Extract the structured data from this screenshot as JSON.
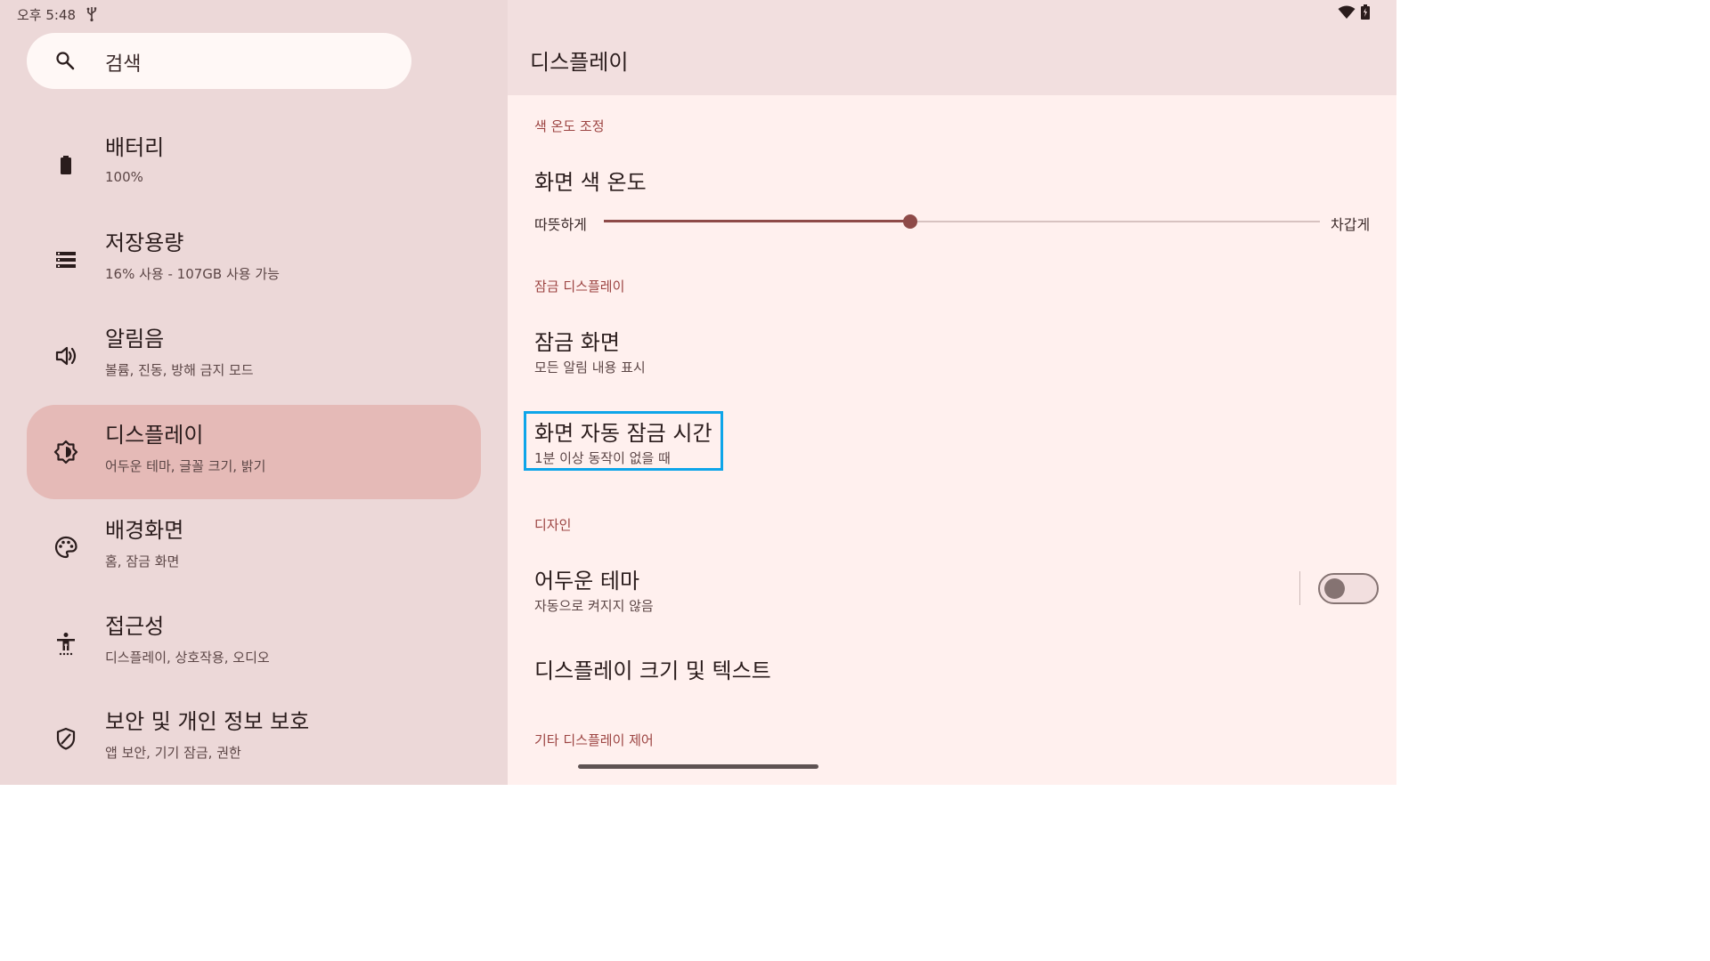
{
  "status_bar": {
    "time": "오후 5:48",
    "icons": [
      "usb-icon",
      "wifi-icon",
      "battery-icon"
    ]
  },
  "search": {
    "placeholder": "검색"
  },
  "sidebar": {
    "items": [
      {
        "icon": "battery-icon",
        "title": "배터리",
        "subtitle": "100%",
        "selected": false
      },
      {
        "icon": "storage-icon",
        "title": "저장용량",
        "subtitle": "16% 사용 - 107GB 사용 가능",
        "selected": false
      },
      {
        "icon": "volume-icon",
        "title": "알림음",
        "subtitle": "볼륨, 진동, 방해 금지 모드",
        "selected": false
      },
      {
        "icon": "brightness-icon",
        "title": "디스플레이",
        "subtitle": "어두운 테마, 글꼴 크기, 밝기",
        "selected": true
      },
      {
        "icon": "palette-icon",
        "title": "배경화면",
        "subtitle": "홈, 잠금 화면",
        "selected": false
      },
      {
        "icon": "accessibility-icon",
        "title": "접근성",
        "subtitle": "디스플레이, 상호작용, 오디오",
        "selected": false
      },
      {
        "icon": "shield-icon",
        "title": "보안 및 개인 정보 보호",
        "subtitle": "앱 보안, 기기 잠금, 권한",
        "selected": false
      }
    ]
  },
  "main": {
    "title": "디스플레이",
    "sections": {
      "color_temp_header": "색 온도 조정",
      "color_temp_title": "화면 색 온도",
      "slider_left": "따뜻하게",
      "slider_right": "차갑게",
      "slider_value": 0.428,
      "lock_display_header": "잠금 디스플레이",
      "lock_screen_title": "잠금 화면",
      "lock_screen_sub": "모든 알림 내용 표시",
      "timeout_title": "화면 자동 잠금 시간",
      "timeout_sub": "1분 이상 동작이 없을 때",
      "design_header": "디자인",
      "dark_theme_title": "어두운 테마",
      "dark_theme_sub": "자동으로 켜지지 않음",
      "dark_theme_on": false,
      "display_size_title": "디스플레이 크기 및 텍스트",
      "other_header": "기타 디스플레이 제어"
    }
  },
  "colors": {
    "accent": "#8e4a48",
    "selected_bg": "#e5bab7",
    "highlight": "#0ea5e9"
  }
}
